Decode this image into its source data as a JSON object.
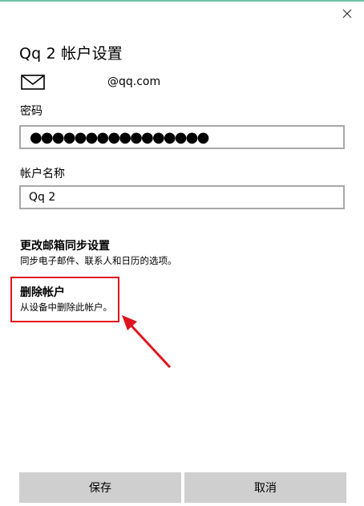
{
  "window": {
    "title": "Qq 2 帐户设置",
    "accent_color": "#6cc7a8"
  },
  "account": {
    "email": "@qq.com",
    "mail_icon": "envelope-icon"
  },
  "password": {
    "label": "密码",
    "value_display": "●●●●●●●●●●●●●●●●"
  },
  "account_name": {
    "label": "帐户名称",
    "value": "Qq 2"
  },
  "sync_settings": {
    "title": "更改邮箱同步设置",
    "description": "同步电子邮件、联系人和日历的选项。"
  },
  "delete_account": {
    "title": "删除帐户",
    "description": "从设备中删除此帐户。"
  },
  "annotation": {
    "color": "#e0141e"
  },
  "buttons": {
    "save": "保存",
    "cancel": "取消"
  }
}
